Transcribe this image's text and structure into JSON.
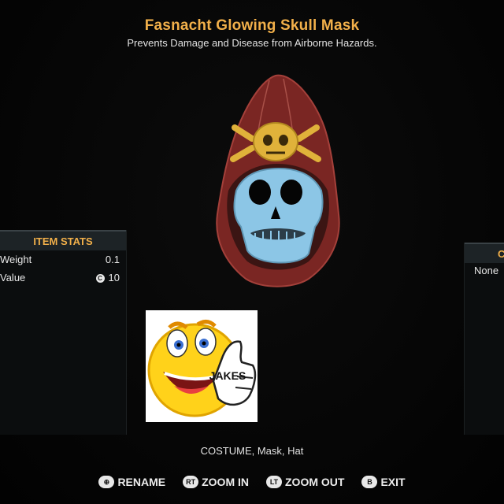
{
  "item": {
    "title": "Fasnacht Glowing Skull Mask",
    "description": "Prevents Damage and Disease from Airborne Hazards.",
    "tags": "COSTUME, Mask, Hat"
  },
  "stats_panel": {
    "header": "ITEM STATS",
    "rows": [
      {
        "label": "Weight",
        "value": "0.1"
      },
      {
        "label": "Value",
        "value": "10",
        "icon": "caps-icon"
      }
    ]
  },
  "right_panel": {
    "header": "C",
    "value": "None"
  },
  "sticker": {
    "text": "JAKES"
  },
  "controls": [
    {
      "glyph": "⊕",
      "label": "RENAME"
    },
    {
      "glyph": "RT",
      "label": "ZOOM IN"
    },
    {
      "glyph": "LT",
      "label": "ZOOM OUT"
    },
    {
      "glyph": "B",
      "label": "EXIT"
    }
  ],
  "colors": {
    "accent": "#f2b04a",
    "panel_bg": "#0b0d0e",
    "panel_header": "#1d2326",
    "mask_hood": "#8a2e2a",
    "skull_blue": "#8cc6e6",
    "emblem_gold": "#e0b23a"
  }
}
